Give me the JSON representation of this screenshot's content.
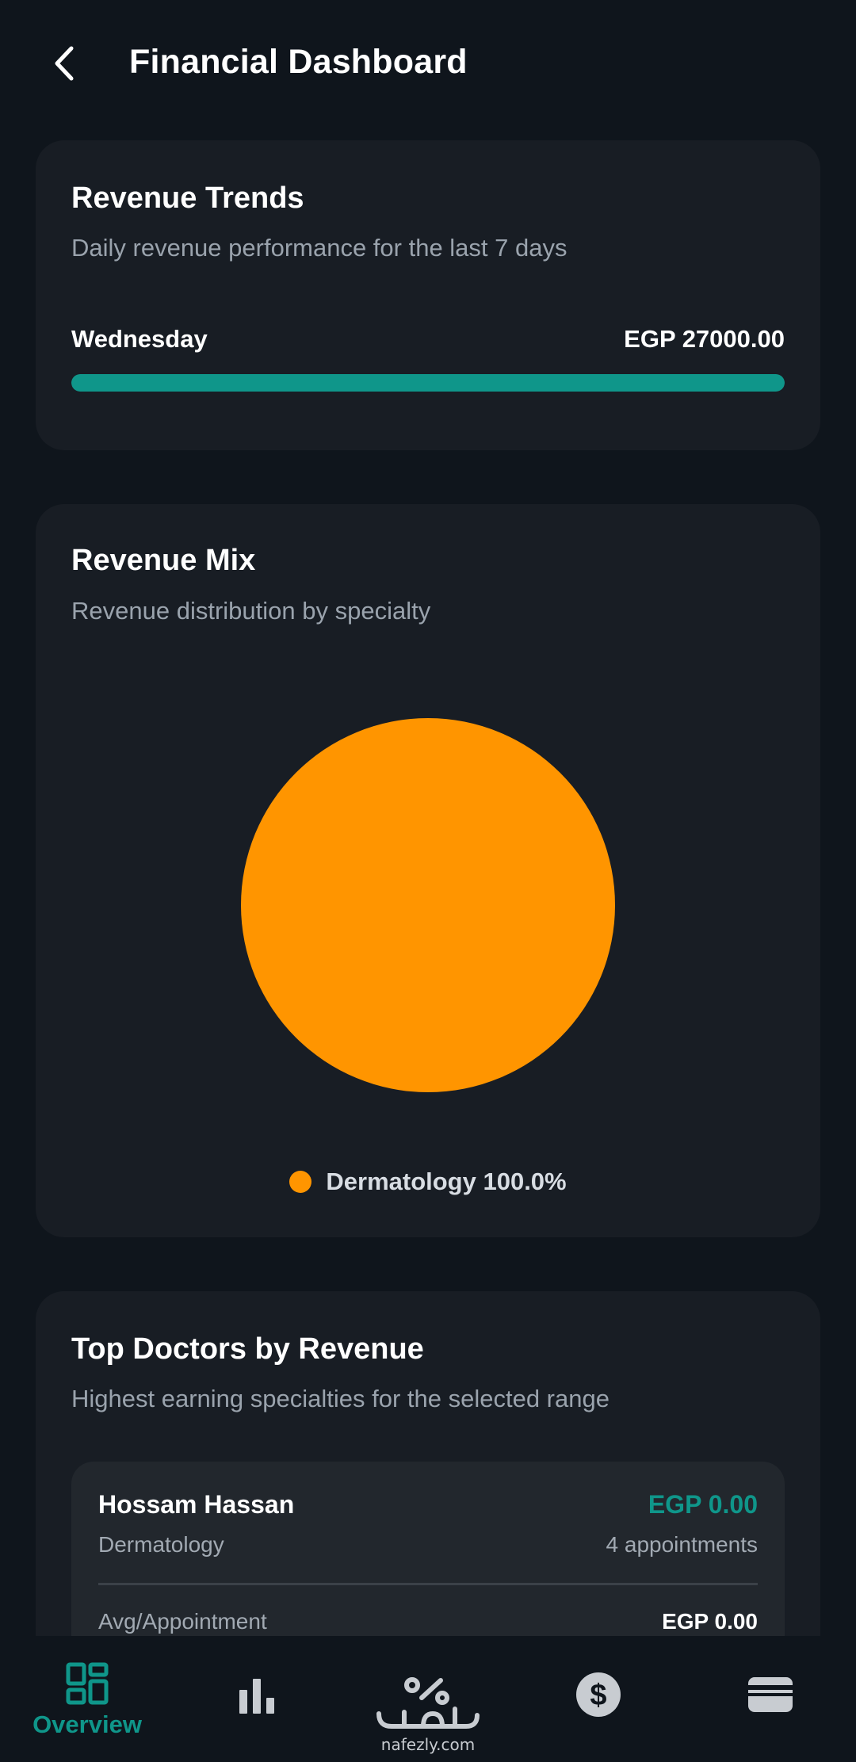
{
  "header": {
    "title": "Financial Dashboard"
  },
  "revenue_trends": {
    "title": "Revenue Trends",
    "subtitle": "Daily revenue performance for the last 7 days",
    "day": "Wednesday",
    "amount": "EGP 27000.00",
    "progress": 1.0,
    "bar_color": "#0f968a"
  },
  "revenue_mix": {
    "title": "Revenue Mix",
    "subtitle": "Revenue distribution by specialty",
    "legend": [
      {
        "label": "Dermatology 100.0%",
        "color": "#ff9500"
      }
    ]
  },
  "chart_data": {
    "type": "pie",
    "categories": [
      "Dermatology"
    ],
    "values": [
      100.0
    ],
    "colors": [
      "#ff9500"
    ],
    "title": "",
    "legend_placement": "bottom"
  },
  "top_doctors": {
    "title": "Top Doctors by Revenue",
    "subtitle": "Highest earning specialties for the selected range",
    "items": [
      {
        "name": "Hossam Hassan",
        "revenue": "EGP 0.00",
        "specialty": "Dermatology",
        "appointments": "4 appointments",
        "avg_label": "Avg/Appointment",
        "avg_value": "EGP 0.00"
      }
    ]
  },
  "bottom_nav": {
    "active_color": "#0f968a",
    "inactive_color": "#c8ccd1",
    "items": [
      {
        "label": "Overview",
        "icon": "dashboard-icon",
        "active": true
      },
      {
        "label": "",
        "icon": "bar-chart-icon",
        "active": false
      },
      {
        "label": "",
        "icon": "dollar-circle-icon",
        "active": false
      },
      {
        "label": "",
        "icon": "wallet-icon",
        "active": false
      }
    ],
    "logo_text": "nafezly.com"
  }
}
